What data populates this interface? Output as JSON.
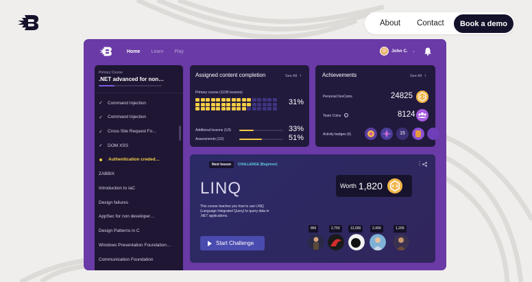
{
  "site_nav": {
    "about": "About",
    "contact": "Contact",
    "book_demo": "Book a demo"
  },
  "app": {
    "tabs": [
      "Home",
      "Learn",
      "Play"
    ],
    "active_tab": "Home",
    "user_name": "John C."
  },
  "sidebar": {
    "course_label": "Primary Course",
    "course_title": ".NET advanced for non…",
    "course_progress": 0.25,
    "lessons": [
      {
        "label": "Command Injection",
        "state": "done"
      },
      {
        "label": "Command Injection",
        "state": "done"
      },
      {
        "label": "Cross Site Request Fo…",
        "state": "done"
      },
      {
        "label": "DOM XSS",
        "state": "done"
      },
      {
        "label": "Authentication creded…",
        "state": "current"
      },
      {
        "label": "ZABBIX",
        "state": "todo"
      },
      {
        "label": "Introduction to IaC",
        "state": "todo"
      },
      {
        "label": "Design failures",
        "state": "todo"
      },
      {
        "label": "AppSec for non developer…",
        "state": "todo"
      },
      {
        "label": "Design Patterns in C",
        "state": "todo"
      },
      {
        "label": "Windows Presentation Foundation…",
        "state": "todo"
      },
      {
        "label": "Communication Foundation",
        "state": "todo"
      }
    ]
  },
  "assigned": {
    "title": "Assigned content completion",
    "see_all": "See All",
    "primary_label": "Primary course (11/35 lessons)",
    "primary_pct": "31%",
    "primary_done": 11,
    "primary_total": 35,
    "additional_label": "Additional lessons (1/3)",
    "additional_pct": "33%",
    "additional_fraction": 0.33,
    "assessments_label": "Assessments (1/2)",
    "assessments_pct": "51%",
    "assessments_fraction": 0.51
  },
  "achievements": {
    "title": "Achievements",
    "see_all": "See All",
    "personal_label": "Personal DevCoins",
    "personal_value": "24825",
    "team_label": "Team Coins",
    "team_value": "8124",
    "badges_label": "Activity badges (6)",
    "badge_number": "15"
  },
  "next_lesson": {
    "tag": "Next lesson",
    "challenge": "CHALLENGE (Beginner)",
    "title": "LINQ",
    "description": "This course teaches you how to use LINQ (Language Integrated Query) to query data in .NET applications.",
    "start_label": "Start Challenge",
    "worth_label": "Worth",
    "worth_value": "1,820",
    "prices": [
      "850",
      "2,750",
      "12,000",
      "2,400",
      "1,200"
    ]
  },
  "colors": {
    "app_bg": "#6a3aa6",
    "panel": "#221a3d",
    "accent_yellow": "#f3cc45",
    "coin_orange": "#f1b54a",
    "demo_btn": "#14112b"
  },
  "icons": [
    "brand-logo-icon",
    "bell-icon",
    "chevron-down-icon",
    "chevron-right-icon",
    "check-icon",
    "info-icon",
    "code-coin-icon",
    "team-icon",
    "play-icon",
    "share-icon",
    "kebab-menu-icon"
  ]
}
